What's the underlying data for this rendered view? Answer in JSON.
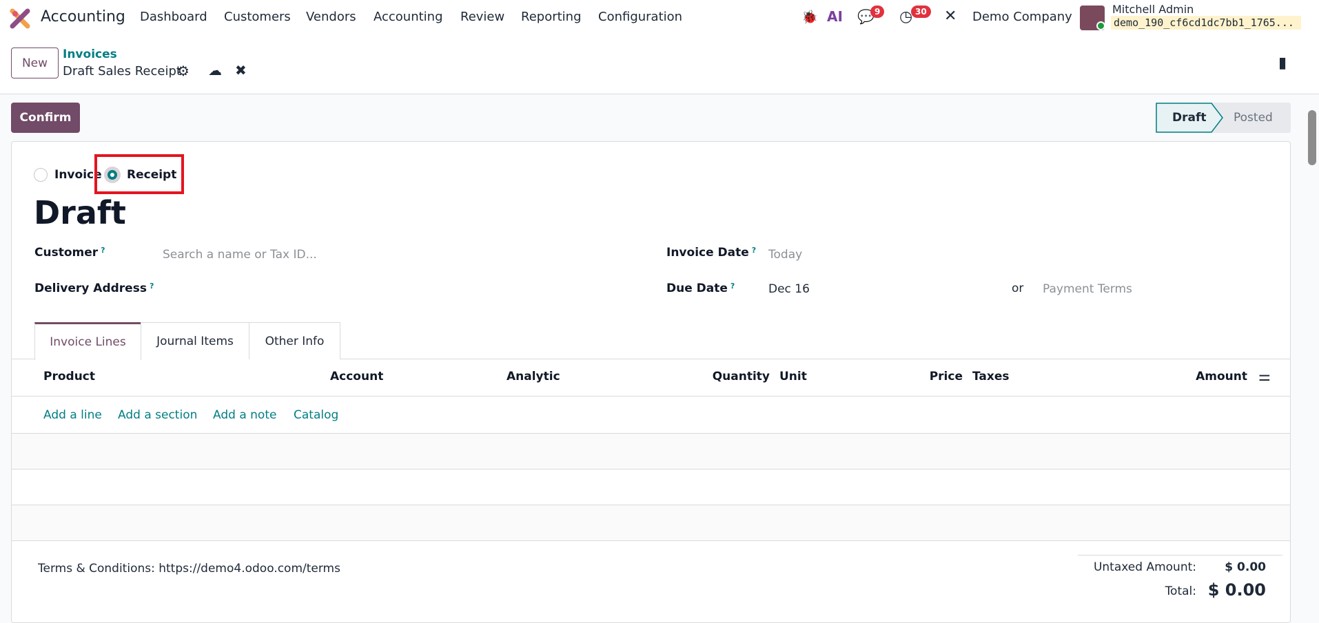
{
  "topnav": {
    "app": "Accounting",
    "menu": [
      "Dashboard",
      "Customers",
      "Vendors",
      "Accounting",
      "Review",
      "Reporting",
      "Configuration"
    ],
    "messages_count": "9",
    "activities_count": "30",
    "company": "Demo Company",
    "user": "Mitchell Admin",
    "database": "demo_190_cf6cd1dc7bb1_1765...",
    "icons": [
      "bug-icon",
      "ai-icon",
      "chat-icon",
      "clock-icon",
      "tools-icon"
    ]
  },
  "control": {
    "new_label": "New",
    "breadcrumb_parent": "Invoices",
    "breadcrumb_current": "Draft Sales Receipt"
  },
  "actions": {
    "confirm_label": "Confirm"
  },
  "status": {
    "steps": [
      "Draft",
      "Posted"
    ],
    "active": "Draft"
  },
  "form": {
    "type_options": [
      "Invoice",
      "Receipt"
    ],
    "selected_type": "Receipt",
    "title": "Draft",
    "customer_label": "Customer",
    "customer_placeholder": "Search a name or Tax ID...",
    "delivery_label": "Delivery Address",
    "invoice_date_label": "Invoice Date",
    "invoice_date_placeholder": "Today",
    "due_date_label": "Due Date",
    "due_date_value": "Dec 16",
    "or": "or",
    "payment_terms_placeholder": "Payment Terms"
  },
  "tabs": [
    "Invoice Lines",
    "Journal Items",
    "Other Info"
  ],
  "table": {
    "columns": [
      "Product",
      "Account",
      "Analytic",
      "Quantity",
      "Unit",
      "Price",
      "Taxes",
      "Amount"
    ],
    "add_links": [
      "Add a line",
      "Add a section",
      "Add a note",
      "Catalog"
    ]
  },
  "footer": {
    "terms": "Terms & Conditions: https://demo4.odoo.com/terms",
    "untaxed_label": "Untaxed Amount:",
    "untaxed_value": "$ 0.00",
    "total_label": "Total:",
    "total_value": "$ 0.00"
  },
  "colors": {
    "primary": "#714b67",
    "accent": "#017e84",
    "highlight": "#e4141f"
  }
}
